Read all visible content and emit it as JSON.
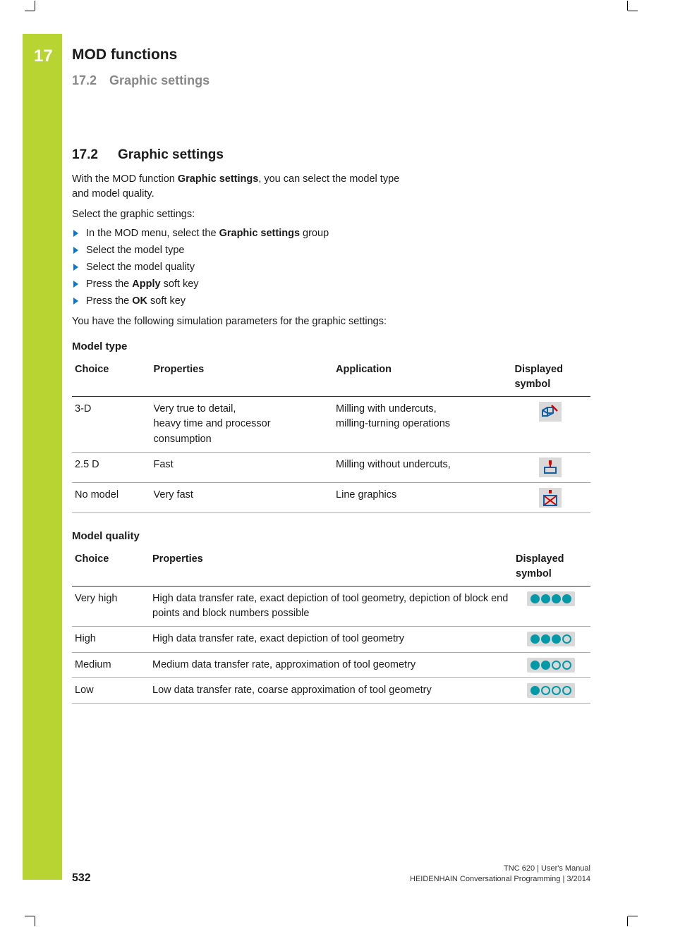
{
  "chapter": {
    "number": "17",
    "title": "MOD functions",
    "subsection_number": "17.2",
    "subsection_title": "Graphic settings"
  },
  "section": {
    "heading_number": "17.2",
    "heading_title": "Graphic settings",
    "intro_pre": "With the MOD function ",
    "intro_bold": "Graphic settings",
    "intro_post": ", you can select the model type and model quality.",
    "lead": "Select the graphic settings:",
    "steps": [
      {
        "pre": "In the MOD menu, select the ",
        "bold": "Graphic settings",
        "post": " group"
      },
      {
        "pre": "Select the model type",
        "bold": "",
        "post": ""
      },
      {
        "pre": "Select the model quality",
        "bold": "",
        "post": ""
      },
      {
        "pre": "Press the ",
        "bold": "Apply",
        "post": " soft key"
      },
      {
        "pre": "Press the ",
        "bold": "OK",
        "post": " soft key"
      }
    ],
    "after": "You have the following simulation parameters for the graphic settings:"
  },
  "table1": {
    "title": "Model type",
    "headers": {
      "c1": "Choice",
      "c2": "Properties",
      "c3": "Application",
      "c4": "Displayed symbol"
    },
    "rows": [
      {
        "choice": "3-D",
        "props": "Very true to detail,\nheavy time and processor consumption",
        "app": "Milling with undercuts,\nmilling-turning operations",
        "icon": "3d"
      },
      {
        "choice": "2.5 D",
        "props": "Fast",
        "app": "Milling without undercuts,",
        "icon": "25d"
      },
      {
        "choice": "No model",
        "props": "Very fast",
        "app": "Line graphics",
        "icon": "nomodel"
      }
    ]
  },
  "table2": {
    "title": "Model quality",
    "headers": {
      "c1": "Choice",
      "c2": "Properties",
      "c3": "Displayed symbol"
    },
    "rows": [
      {
        "choice": "Very high",
        "props": "High data transfer rate, exact depiction of tool geometry, depiction of block end points and block numbers possible",
        "dots": 4
      },
      {
        "choice": "High",
        "props": "High data transfer rate, exact depiction of tool geometry",
        "dots": 3
      },
      {
        "choice": "Medium",
        "props": "Medium data transfer rate, approximation of tool geometry",
        "dots": 2
      },
      {
        "choice": "Low",
        "props": "Low data transfer rate, coarse approximation of tool geometry",
        "dots": 1
      }
    ]
  },
  "footer": {
    "page": "532",
    "line1": "TNC 620 | User's Manual",
    "line2": "HEIDENHAIN Conversational Programming | 3/2014"
  }
}
